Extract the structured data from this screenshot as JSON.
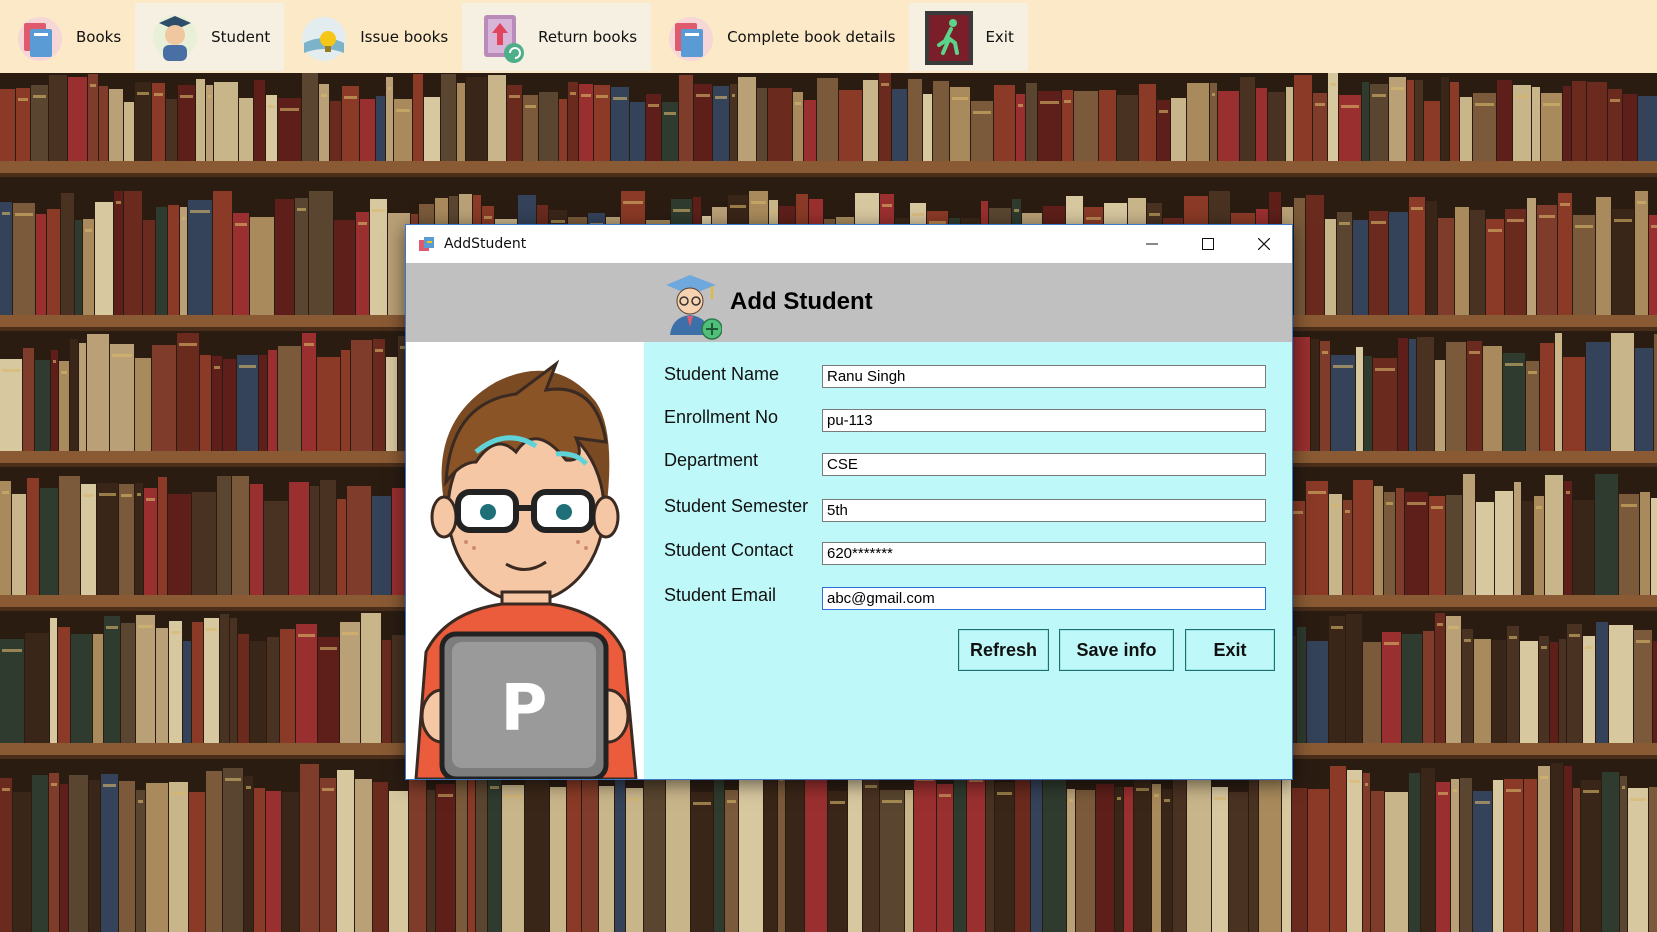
{
  "menu": {
    "items": [
      {
        "label": "Books",
        "icon": "books-icon"
      },
      {
        "label": "Student",
        "icon": "student-icon"
      },
      {
        "label": "Issue books",
        "icon": "issue-books-icon"
      },
      {
        "label": "Return books",
        "icon": "return-books-icon"
      },
      {
        "label": "Complete book details",
        "icon": "book-details-icon"
      },
      {
        "label": "Exit",
        "icon": "exit-icon"
      }
    ]
  },
  "dialog": {
    "title": "AddStudent",
    "header": "Add Student",
    "fields": [
      {
        "label": "Student Name",
        "value": "Ranu Singh"
      },
      {
        "label": "Enrollment No",
        "value": "pu-113"
      },
      {
        "label": "Department",
        "value": "CSE"
      },
      {
        "label": "Student Semester",
        "value": "5th"
      },
      {
        "label": "Student Contact",
        "value": "620*******"
      },
      {
        "label": "Student Email",
        "value": "abc@gmail.com"
      }
    ],
    "buttons": {
      "refresh": "Refresh",
      "save": "Save info",
      "exit": "Exit"
    },
    "laptop_letter": "P"
  },
  "colors": {
    "menu_bg": "#fbe9c8",
    "header_band": "#c0c0c0",
    "form_bg": "#bff8f8"
  }
}
